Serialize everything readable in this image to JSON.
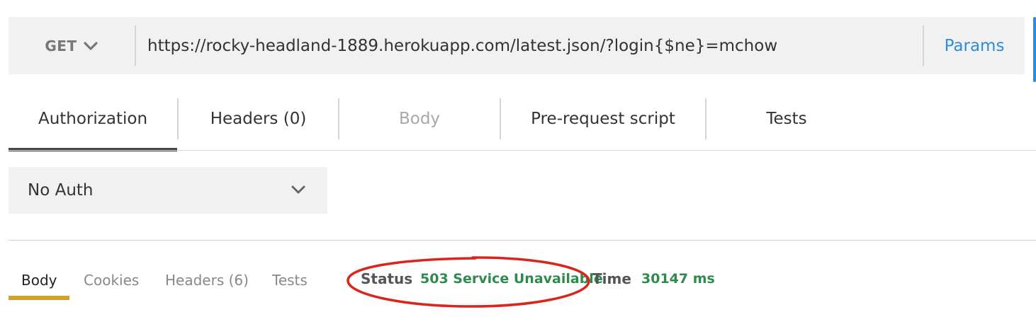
{
  "request": {
    "method": "GET",
    "url": "https://rocky-headland-1889.herokuapp.com/latest.json/?login{$ne}=mchow",
    "params_label": "Params"
  },
  "request_tabs": [
    {
      "label": "Authorization",
      "state": "active"
    },
    {
      "label": "Headers (0)",
      "state": "normal"
    },
    {
      "label": "Body",
      "state": "disabled"
    },
    {
      "label": "Pre-request script",
      "state": "normal"
    },
    {
      "label": "Tests",
      "state": "normal"
    }
  ],
  "auth": {
    "selected": "No Auth"
  },
  "response_tabs": [
    {
      "label": "Body",
      "state": "active"
    },
    {
      "label": "Cookies",
      "state": "normal"
    },
    {
      "label": "Headers (6)",
      "state": "normal"
    },
    {
      "label": "Tests",
      "state": "normal"
    }
  ],
  "response_meta": {
    "status_label": "Status",
    "status_value": "503 Service Unavailable",
    "time_label": "Time",
    "time_value": "30147 ms"
  },
  "icons": {
    "method_dropdown": "chevron-down-icon",
    "auth_dropdown": "chevron-down-icon"
  },
  "colors": {
    "accent_blue": "#2f8cdb",
    "status_green": "#2e8b4d",
    "active_tab_underline": "#464646",
    "response_tab_underline": "#d0a227",
    "annotation_red": "#d9261c"
  }
}
